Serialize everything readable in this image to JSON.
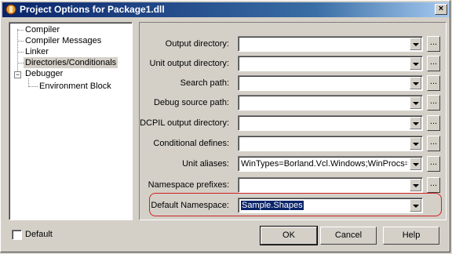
{
  "window": {
    "title": "Project Options for Package1.dll",
    "close_label": "×"
  },
  "tree": {
    "items": [
      {
        "label": "Compiler"
      },
      {
        "label": "Compiler Messages"
      },
      {
        "label": "Linker"
      },
      {
        "label": "Directories/Conditionals",
        "selected": true
      },
      {
        "label": "Debugger",
        "expander": "−"
      },
      {
        "label": "Environment Block"
      }
    ]
  },
  "fields": [
    {
      "label": "Output directory:",
      "value": "",
      "has_browse": true
    },
    {
      "label": "Unit output directory:",
      "value": "",
      "has_browse": true
    },
    {
      "label": "Search path:",
      "value": "",
      "has_browse": true
    },
    {
      "label": "Debug source path:",
      "value": "",
      "has_browse": true
    },
    {
      "label": "DCPIL output directory:",
      "value": "",
      "has_browse": true
    },
    {
      "label": "Conditional defines:",
      "value": "",
      "has_browse": true
    },
    {
      "label": "Unit aliases:",
      "value": "WinTypes=Borland.Vcl.Windows;WinProcs=Borlan",
      "has_browse": true
    },
    {
      "label": "Namespace prefixes:",
      "value": "",
      "has_browse": true
    },
    {
      "label": "Default Namespace:",
      "value": "Sample.Shapes",
      "has_browse": false,
      "highlighted": true
    }
  ],
  "browse_label": "...",
  "footer": {
    "default_checkbox_label": "Default",
    "ok_label": "OK",
    "cancel_label": "Cancel",
    "help_label": "Help"
  },
  "colors": {
    "title_gradient_start": "#0a246a",
    "title_gradient_end": "#a6caf0",
    "highlight_outline": "#cc2222",
    "face": "#d4d0c8"
  }
}
